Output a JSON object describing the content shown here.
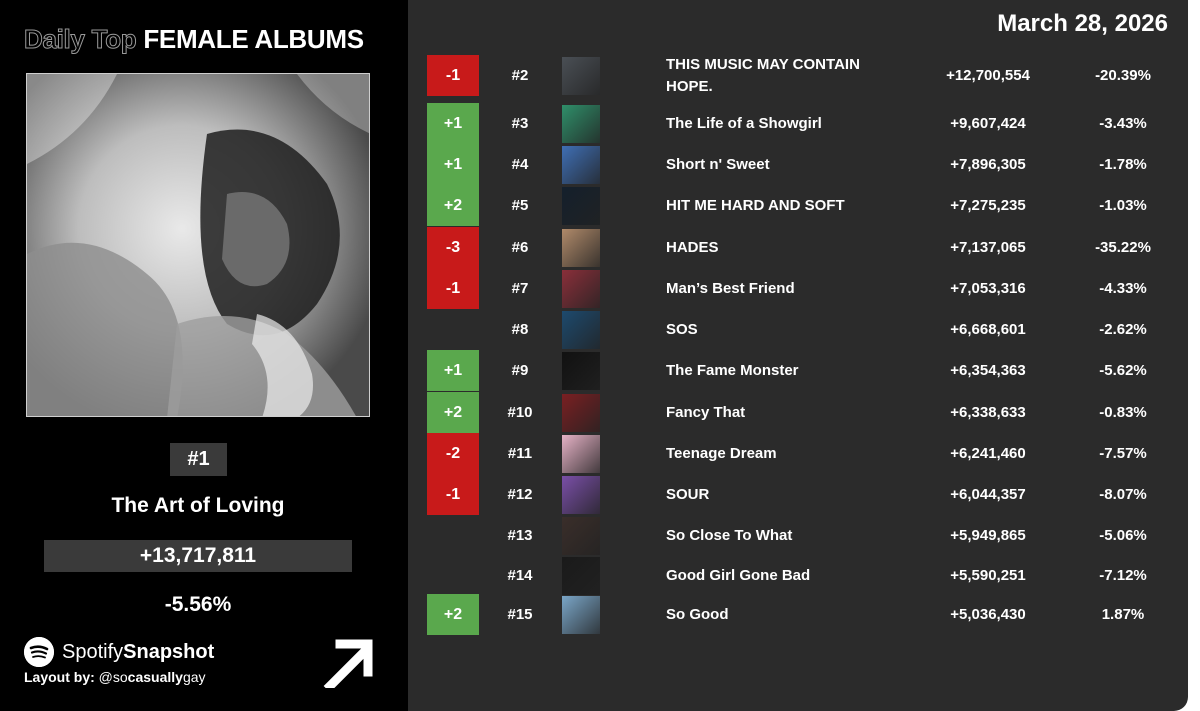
{
  "header": {
    "title_light": "Daily Top",
    "title_bold": "FEMALE ALBUMS",
    "date": "March 28, 2026"
  },
  "top": {
    "rank": "#1",
    "album": "The Art of Loving",
    "streams": "+13,717,811",
    "change_pct": "-5.56%"
  },
  "footer": {
    "brand_light": "Spotify",
    "brand_bold": "Snapshot",
    "credit_label": "Layout by:",
    "credit_handle_light": "@so",
    "credit_handle_bold": "casually",
    "credit_handle_end": "gay"
  },
  "colors": {
    "up": "#5aa84d",
    "down": "#c81a1a",
    "panel": "#2b2b2b",
    "left_bg": "#000000"
  },
  "rows": [
    {
      "change": "-1",
      "dir": "down",
      "rank": "#2",
      "album": "THIS MUSIC MAY CONTAIN HOPE.",
      "streams": "+12,700,554",
      "pct": "-20.39%",
      "thumb": "#4a4f55"
    },
    {
      "change": "+1",
      "dir": "up",
      "rank": "#3",
      "album": "The Life of a Showgirl",
      "streams": "+9,607,424",
      "pct": "-3.43%",
      "thumb": "#2f8f6a"
    },
    {
      "change": "+1",
      "dir": "up",
      "rank": "#4",
      "album": "Short n' Sweet",
      "streams": "+7,896,305",
      "pct": "-1.78%",
      "thumb": "#3f6fb5"
    },
    {
      "change": "+2",
      "dir": "up",
      "rank": "#5",
      "album": "HIT ME HARD AND SOFT",
      "streams": "+7,275,235",
      "pct": "-1.03%",
      "thumb": "#14202c"
    },
    {
      "change": "-3",
      "dir": "down",
      "rank": "#6",
      "album": "HADES",
      "streams": "+7,137,065",
      "pct": "-35.22%",
      "thumb": "#b08a6a"
    },
    {
      "change": "-1",
      "dir": "down",
      "rank": "#7",
      "album": "Man’s Best Friend",
      "streams": "+7,053,316",
      "pct": "-4.33%",
      "thumb": "#8a2f3a"
    },
    {
      "change": "",
      "dir": "none",
      "rank": "#8",
      "album": "SOS",
      "streams": "+6,668,601",
      "pct": "-2.62%",
      "thumb": "#1d4a6e"
    },
    {
      "change": "+1",
      "dir": "up",
      "rank": "#9",
      "album": "The Fame Monster",
      "streams": "+6,354,363",
      "pct": "-5.62%",
      "thumb": "#111111"
    },
    {
      "change": "+2",
      "dir": "up",
      "rank": "#10",
      "album": "Fancy That",
      "streams": "+6,338,633",
      "pct": "-0.83%",
      "thumb": "#7a1f22"
    },
    {
      "change": "-2",
      "dir": "down",
      "rank": "#11",
      "album": "Teenage Dream",
      "streams": "+6,241,460",
      "pct": "-7.57%",
      "thumb": "#e6b2c6"
    },
    {
      "change": "-1",
      "dir": "down",
      "rank": "#12",
      "album": "SOUR",
      "streams": "+6,044,357",
      "pct": "-8.07%",
      "thumb": "#7a4fa8"
    },
    {
      "change": "",
      "dir": "none",
      "rank": "#13",
      "album": "So Close To What",
      "streams": "+5,949,865",
      "pct": "-5.06%",
      "thumb": "#3a2e2a"
    },
    {
      "change": "",
      "dir": "none",
      "rank": "#14",
      "album": "Good Girl Gone Bad",
      "streams": "+5,590,251",
      "pct": "-7.12%",
      "thumb": "#1a1a1a"
    },
    {
      "change": "+2",
      "dir": "up",
      "rank": "#15",
      "album": "So Good",
      "streams": "+5,036,430",
      "pct": "1.87%",
      "thumb": "#7aa6c8"
    }
  ]
}
